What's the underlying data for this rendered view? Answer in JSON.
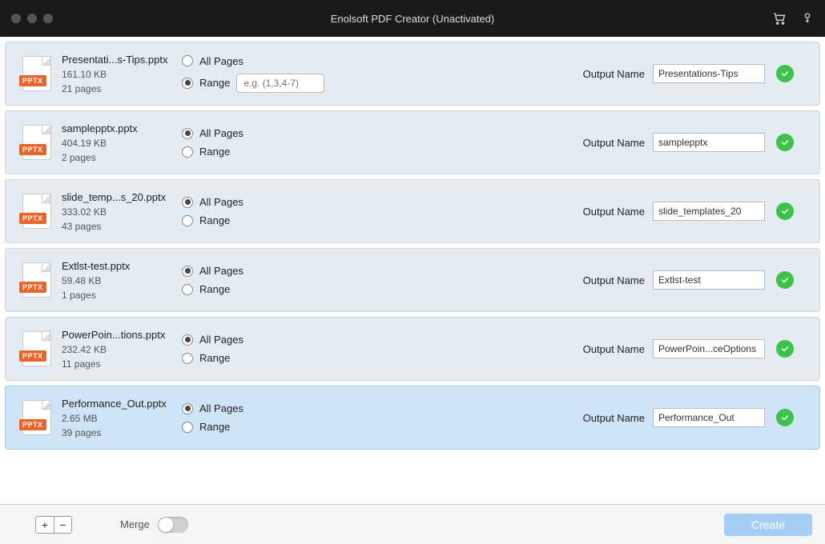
{
  "title": "Enolsoft PDF Creator (Unactivated)",
  "labels": {
    "allPages": "All Pages",
    "range": "Range",
    "outputName": "Output Name",
    "rangePlaceholder": "e.g. (1,3,4-7)",
    "merge": "Merge",
    "create": "Create",
    "fileTag": "PPTX",
    "add": "+",
    "remove": "−"
  },
  "rows": [
    {
      "name": "Presentati...s-Tips.pptx",
      "size": "161.10 KB",
      "pages": "21 pages",
      "mode": "range",
      "output": "Presentations-Tips",
      "selected": false
    },
    {
      "name": "samplepptx.pptx",
      "size": "404.19 KB",
      "pages": "2 pages",
      "mode": "all",
      "output": "samplepptx",
      "selected": false
    },
    {
      "name": "slide_temp...s_20.pptx",
      "size": "333.02 KB",
      "pages": "43 pages",
      "mode": "all",
      "output": "slide_templates_20",
      "selected": false
    },
    {
      "name": "Extlst-test.pptx",
      "size": "59.48 KB",
      "pages": "1 pages",
      "mode": "all",
      "output": "Extlst-test",
      "selected": false
    },
    {
      "name": "PowerPoin...tions.pptx",
      "size": "232.42 KB",
      "pages": "11 pages",
      "mode": "all",
      "output": "PowerPoin...ceOptions",
      "selected": false
    },
    {
      "name": "Performance_Out.pptx",
      "size": "2.65 MB",
      "pages": "39 pages",
      "mode": "all",
      "output": "Performance_Out",
      "selected": true
    }
  ]
}
